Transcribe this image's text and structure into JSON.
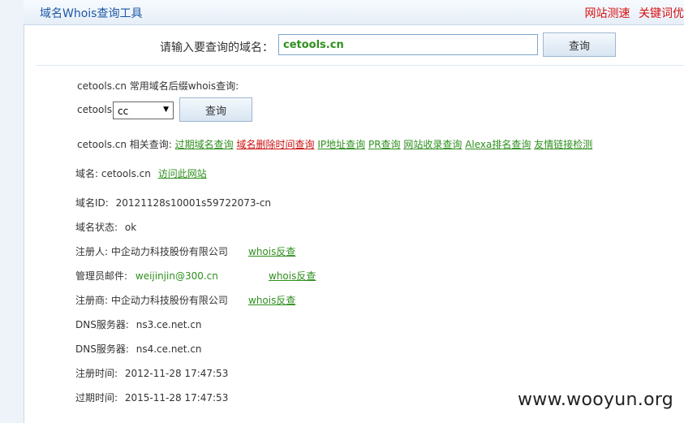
{
  "header": {
    "title": "域名Whois查询工具",
    "links": [
      "网站测速",
      "关键词优"
    ]
  },
  "search": {
    "label": "请输入要查询的域名：",
    "value": "cetools.cn",
    "button": "查询"
  },
  "suffix": {
    "heading": "cetools.cn 常用域名后缀whois查询:",
    "prefix": "cetools.",
    "selected": "cc",
    "button": "查询"
  },
  "related": {
    "label": "cetools.cn 相关查询:",
    "links": [
      "过期域名查询",
      "域名删除时间查询",
      "IP地址查询",
      "PR查询",
      "网站收录查询",
      "Alexa排名查询",
      "友情链接检测"
    ]
  },
  "whois": {
    "domain_label": "域名:",
    "domain_value": "cetools.cn",
    "visit_link": "访问此网站",
    "id_label": "域名ID:",
    "id_value": "20121128s10001s59722073-cn",
    "status_label": "域名状态:",
    "status_value": "ok",
    "registrant_label": "注册人:",
    "registrant_value": "中企动力科技股份有限公司",
    "registrant_reverse": "whois反查",
    "email_label": "管理员邮件:",
    "email_value": "weijinjin@300.cn",
    "email_reverse": "whois反查",
    "registrar_label": "注册商:",
    "registrar_value": "中企动力科技股份有限公司",
    "registrar_reverse": "whois反查",
    "dns1_label": "DNS服务器:",
    "dns1_value": "ns3.ce.net.cn",
    "dns2_label": "DNS服务器:",
    "dns2_value": "ns4.ce.net.cn",
    "created_label": "注册时间:",
    "created_value": "2012-11-28 17:47:53",
    "expires_label": "过期时间:",
    "expires_value": "2015-11-28 17:47:53"
  },
  "watermark": "www.wooyun.org",
  "colors": {
    "link_green": "#2f8f1e",
    "link_red": "#cc1010",
    "title_blue": "#1d57a5"
  }
}
